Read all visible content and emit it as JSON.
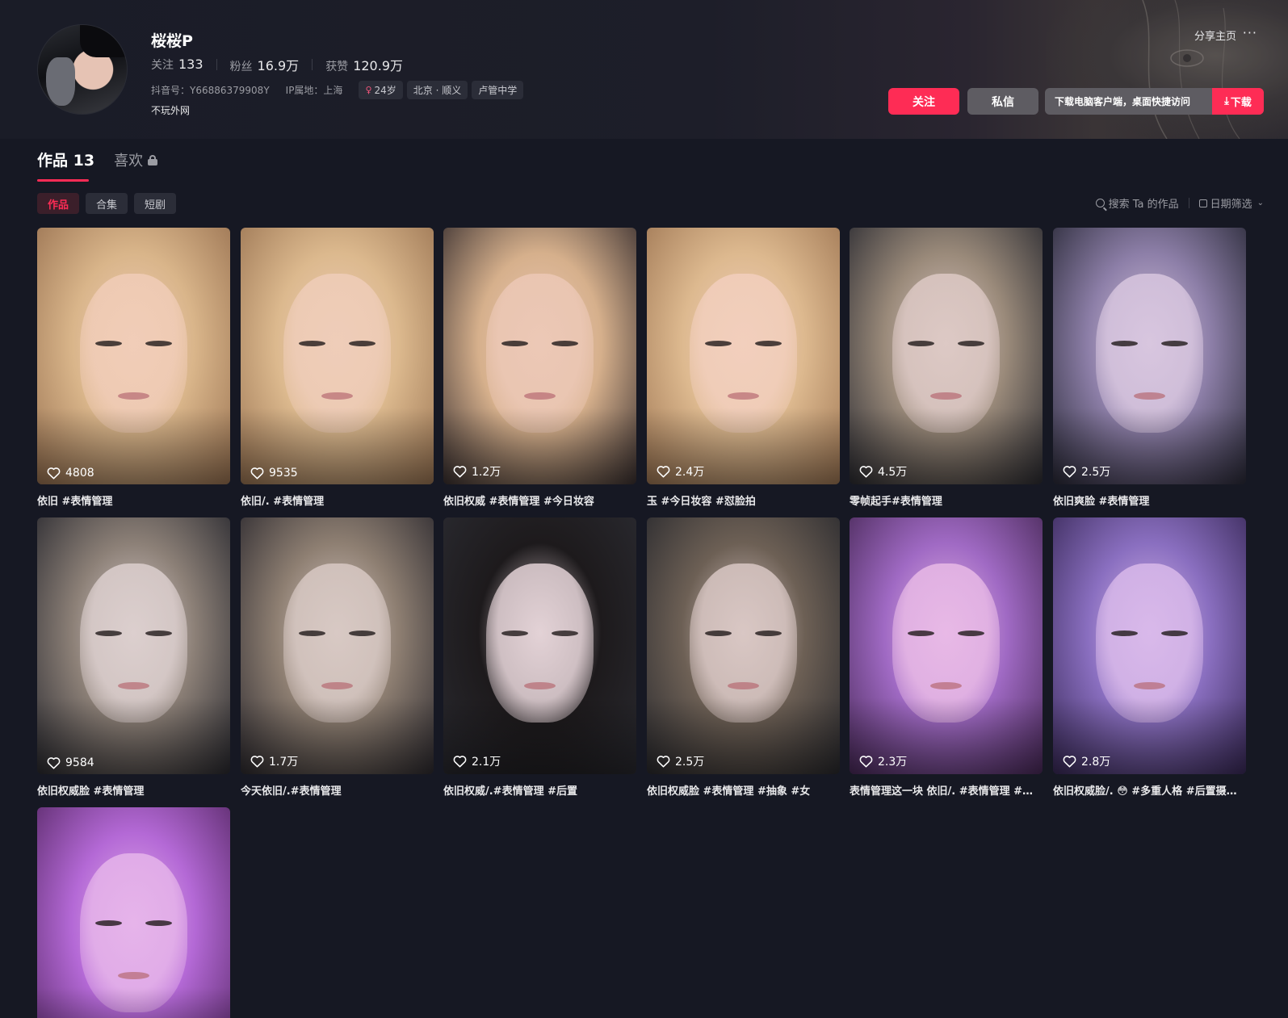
{
  "profile": {
    "nickname": "桜桜P",
    "stats": [
      {
        "label": "关注",
        "value": "133"
      },
      {
        "label": "粉丝",
        "value": "16.9万"
      },
      {
        "label": "获赞",
        "value": "120.9万"
      }
    ],
    "douyin_id": "抖音号：Y66886379908Y",
    "ip_location": "IP属地：上海",
    "tags": [
      "24岁",
      "北京 · 顺义",
      "卢管中学"
    ],
    "bio": "不玩外网"
  },
  "header": {
    "share_label": "分享主页",
    "more_label": "···",
    "follow_label": "关注",
    "message_label": "私信",
    "download_text": "下载电脑客户端，桌面快捷访问",
    "download_button": "下载"
  },
  "tabs": {
    "works_label": "作品",
    "works_count": "13",
    "likes_label": "喜欢"
  },
  "chips": [
    "作品",
    "合集",
    "短剧"
  ],
  "toolbar": {
    "search_label": "搜索 Ta 的作品",
    "date_filter_label": "日期筛选"
  },
  "videos": [
    {
      "likes": "4808",
      "title": "依旧 #表情管理"
    },
    {
      "likes": "9535",
      "title": "依旧/. #表情管理"
    },
    {
      "likes": "1.2万",
      "title": "依旧权威 #表情管理 #今日妆容"
    },
    {
      "likes": "2.4万",
      "title": "玉 #今日妆容 #怼脸拍"
    },
    {
      "likes": "4.5万",
      "title": "零帧起手#表情管理"
    },
    {
      "likes": "2.5万",
      "title": "依旧爽脸 #表情管理"
    },
    {
      "likes": "9584",
      "title": "依旧权威脸 #表情管理"
    },
    {
      "likes": "1.7万",
      "title": "今天依旧/.#表情管理"
    },
    {
      "likes": "2.1万",
      "title": "依旧权威/.#表情管理 #后置"
    },
    {
      "likes": "2.5万",
      "title": "依旧权威脸 #表情管理 #抽象 #女"
    },
    {
      "likes": "2.3万",
      "title": "表情管理这一块 依旧/. #表情管理 #…"
    },
    {
      "likes": "2.8万",
      "title": "依旧权威脸/. 😳 #多重人格 #后置摄…"
    },
    {
      "likes": "",
      "title": ""
    }
  ],
  "colors": {
    "background": "#161823",
    "accent": "#fe2c55",
    "secondary_button": "#5e5c62"
  }
}
